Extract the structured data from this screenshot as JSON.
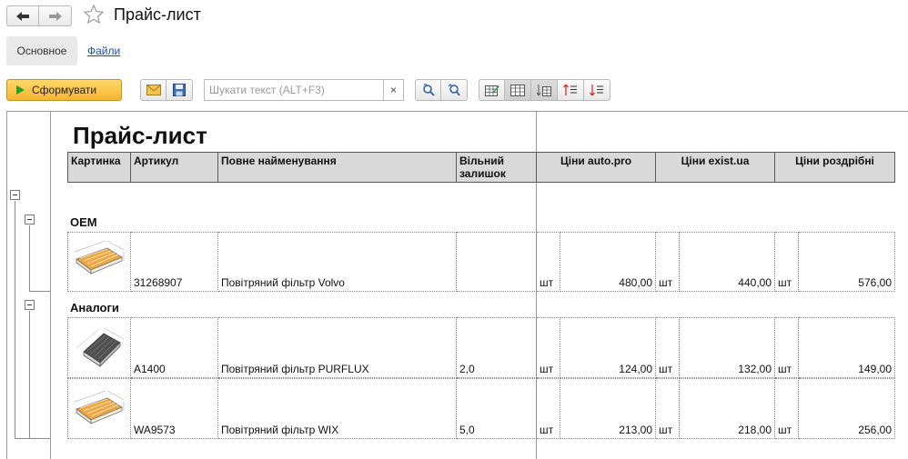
{
  "header": {
    "title": "Прайс-лист"
  },
  "tabs": {
    "main": "Основное",
    "files": "Файли"
  },
  "toolbar": {
    "generate_label": "Сформувати",
    "search_placeholder": "Шукати текст (ALT+F3)",
    "clear_symbol": "×"
  },
  "report": {
    "title": "Прайс-лист",
    "columns": {
      "picture": "Картинка",
      "article": "Артикул",
      "full_name": "Повне найменування",
      "free_stock": "Вільний залишок",
      "prices_autopro": "Ціни auto.pro",
      "prices_exist": "Ціни exist.ua",
      "prices_retail": "Ціни роздрібні"
    },
    "groups": {
      "oem": "OEM",
      "analogs": "Аналоги"
    },
    "rows": [
      {
        "article": "31268907",
        "name": "Повітряний фільтр Volvo",
        "stock": "",
        "u1": "шт",
        "p1": "480,00",
        "u2": "шт",
        "p2": "440,00",
        "u3": "шт",
        "p3": "576,00"
      },
      {
        "article": "A1400",
        "name": "Повітряний фільтр PURFLUX",
        "stock": "2,0",
        "u1": "шт",
        "p1": "124,00",
        "u2": "шт",
        "p2": "132,00",
        "u3": "шт",
        "p3": "149,00"
      },
      {
        "article": "WA9573",
        "name": "Повітряний фільтр WIX",
        "stock": "5,0",
        "u1": "шт",
        "p1": "213,00",
        "u2": "шт",
        "p2": "218,00",
        "u3": "шт",
        "p3": "256,00"
      }
    ]
  }
}
